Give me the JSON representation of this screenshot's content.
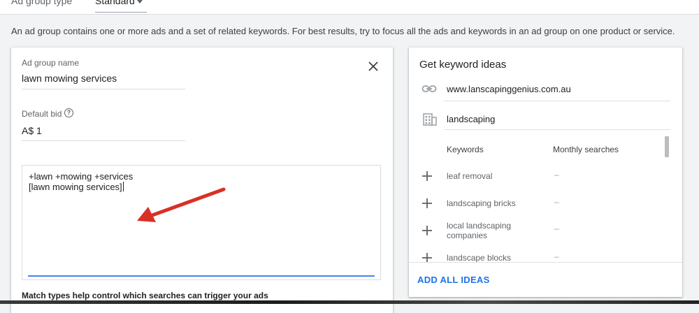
{
  "header": {
    "ad_group_type_label": "Ad group type",
    "ad_group_type_value": "Standard"
  },
  "description": "An ad group contains one or more ads and a set of related keywords. For best results, try to focus all the ads and keywords in an ad group on one product or service.",
  "ad_group": {
    "name_label": "Ad group name",
    "name_value": "lawn mowing services",
    "bid_label": "Default bid",
    "bid_value": "A$ 1",
    "keywords": [
      "+lawn +mowing +services",
      "[lawn mowing services]"
    ],
    "match_note": "Match types help control which searches can trigger your ads"
  },
  "keyword_ideas": {
    "title": "Get keyword ideas",
    "website": "www.lanscapinggenius.com.au",
    "product": "landscaping",
    "columns": {
      "keywords": "Keywords",
      "monthly": "Monthly searches"
    },
    "rows": [
      {
        "keyword": "leaf removal",
        "monthly": "–"
      },
      {
        "keyword": "landscaping bricks",
        "monthly": "–"
      },
      {
        "keyword_line1": "local landscaping",
        "keyword_line2": "companies",
        "monthly": "–"
      },
      {
        "keyword": "landscape blocks",
        "monthly": "–"
      }
    ],
    "add_all_label": "ADD ALL IDEAS"
  },
  "colors": {
    "accent": "#1a73e8",
    "focus": "#4285f4",
    "annotation_arrow": "#d93025"
  },
  "icons": [
    "close-icon",
    "help-icon",
    "link-icon",
    "building-icon",
    "plus-icon",
    "chevron-down-icon"
  ]
}
